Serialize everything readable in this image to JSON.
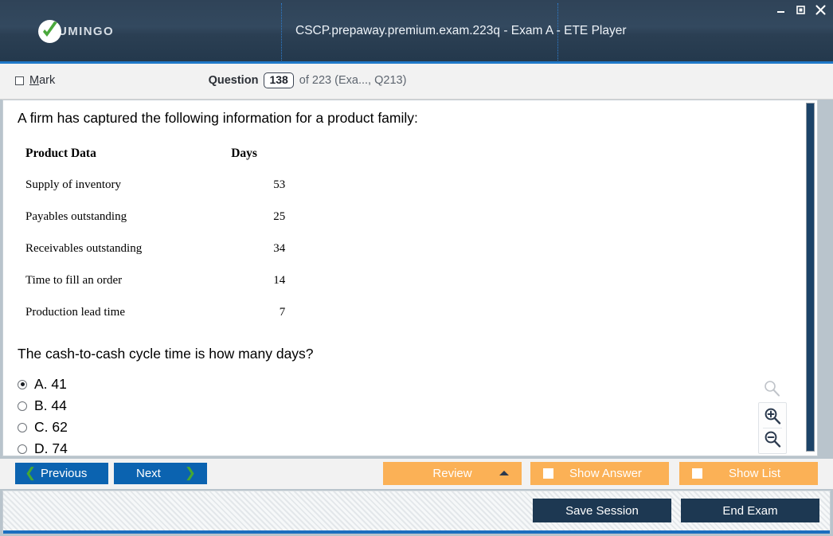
{
  "titlebar": {
    "logo_text": "UMINGO",
    "logo_icon": "check-circle-icon",
    "window_title": "CSCP.prepaway.premium.exam.223q - Exam A - ETE Player",
    "minimize_label": "Minimize",
    "maximize_label": "Maximize",
    "close_label": "Close"
  },
  "question_bar": {
    "mark_label_pre": "",
    "mark_label_accel": "M",
    "mark_label_post": "ark",
    "mark_checked": false,
    "question_word": "Question",
    "question_number": "138",
    "rest": "of 223 (Exa..., Q213)"
  },
  "content": {
    "intro": "A firm has captured the following information for a product family:",
    "table": {
      "headers": [
        "Product Data",
        "Days"
      ],
      "rows": [
        {
          "label": "Supply of inventory",
          "days": "53"
        },
        {
          "label": "Payables outstanding",
          "days": "25"
        },
        {
          "label": "Receivables outstanding",
          "days": "34"
        },
        {
          "label": "Time to fill an order",
          "days": "14"
        },
        {
          "label": "Production lead time",
          "days": "7"
        }
      ]
    },
    "prompt": "The cash-to-cash cycle time is how many days?",
    "options": [
      {
        "text": "A. 41",
        "selected": true
      },
      {
        "text": "B. 44",
        "selected": false
      },
      {
        "text": "C. 62",
        "selected": false
      },
      {
        "text": "D. 74",
        "selected": false
      }
    ],
    "zoom_tools": {
      "ghost_icon": "magnifier-icon",
      "zoom_in_icon": "magnifier-plus-icon",
      "zoom_out_icon": "magnifier-minus-icon"
    }
  },
  "action_bar": {
    "previous_label": "Previous",
    "previous_icon": "chevron-left-icon",
    "next_label": "Next",
    "next_icon": "chevron-right-icon",
    "review_label": "Review",
    "review_icon": "caret-up-icon",
    "show_answer_label": "Show Answer",
    "show_answer_checked": false,
    "show_list_label": "Show List",
    "show_list_checked": false
  },
  "footer": {
    "save_session_label": "Save Session",
    "end_exam_label": "End Exam"
  },
  "colors": {
    "titlebar_dark": "#2f4358",
    "accent_blue": "#1f78c8",
    "button_blue": "#0b63b0",
    "button_orange": "#fbb156",
    "button_navy": "#1d3852",
    "chevron_green": "#46a832",
    "scrollbar_thumb": "#1c4368"
  }
}
